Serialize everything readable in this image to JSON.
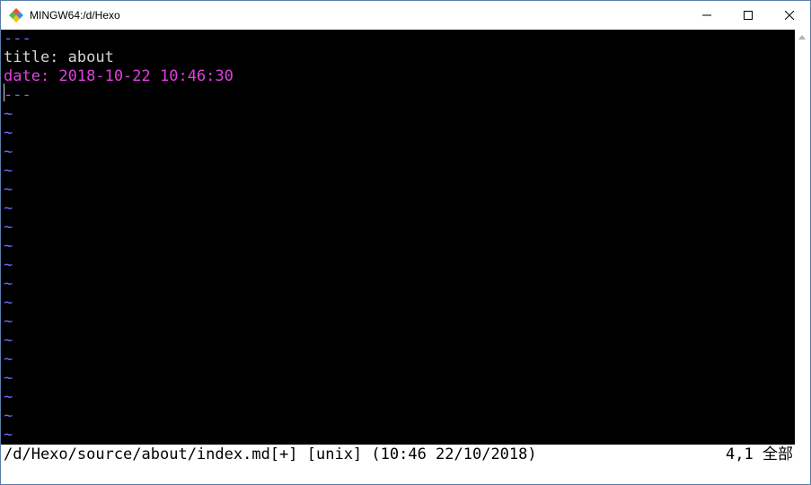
{
  "window": {
    "title": "MINGW64:/d/Hexo",
    "icon": "git-diamond-icon",
    "buttons": {
      "minimize": "minimize-icon",
      "maximize": "maximize-icon",
      "close": "close-icon"
    }
  },
  "editor": {
    "lines": [
      {
        "text": "---",
        "color": "#6b6bff"
      },
      {
        "key": "title: ",
        "value": "about",
        "color": "#d4d4d4"
      },
      {
        "text": "date: 2018-10-22 10:46:30",
        "color": "#e040e0"
      },
      {
        "text": "---",
        "color": "#6b6bff"
      }
    ],
    "tilde": "~",
    "tilde_count": 18
  },
  "status": {
    "left": "/d/Hexo/source/about/index.md[+] [unix] (10:46 22/10/2018)",
    "right": "4,1 全部"
  },
  "colors": {
    "fm_delim": "#6b6bff",
    "date": "#e040e0",
    "text": "#d4d4d4",
    "background": "#000000"
  }
}
